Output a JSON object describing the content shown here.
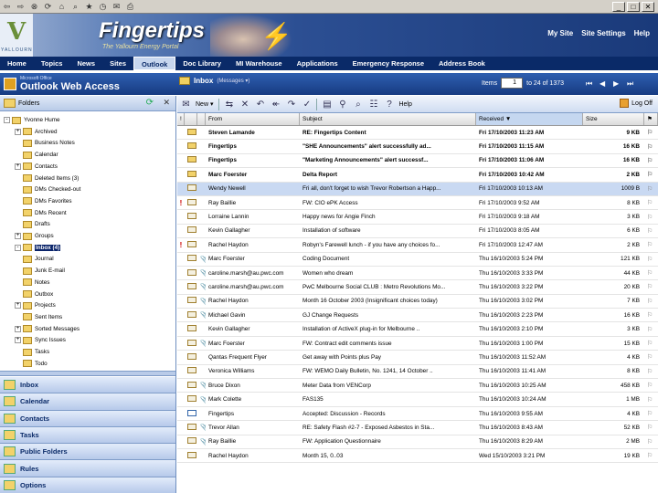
{
  "browser": {
    "buttons": [
      "back-arrow-icon",
      "forward-arrow-icon",
      "stop-icon",
      "refresh-icon",
      "home-icon",
      "search-icon",
      "favorites-icon",
      "history-icon",
      "mail-icon",
      "print-icon"
    ],
    "glyphs": [
      "⇦",
      "⇨",
      "⊗",
      "⟳",
      "⌂",
      "⌕",
      "★",
      "◷",
      "✉",
      "⎙"
    ],
    "window_controls": [
      "_",
      "□",
      "✕"
    ]
  },
  "banner": {
    "brand_letter": "V",
    "brand_text": "YALLOURN",
    "title": "Fingertips",
    "tagline": "The Yallourn Energy Portal",
    "links": [
      "My Site",
      "Site Settings",
      "Help"
    ]
  },
  "nav": {
    "items": [
      "Home",
      "Topics",
      "News",
      "Sites",
      "Outlook",
      "Doc Library",
      "MI Warehouse",
      "Applications",
      "Emergency Response",
      "Address Book"
    ],
    "active_index": 4
  },
  "owa": {
    "ms_label": "Microsoft Office",
    "title": "Outlook Web Access",
    "folder": "Inbox",
    "folder_view": "(Messages ▾)",
    "items_label": "Items",
    "page_value": "1",
    "range_label": "to 24 of 1373"
  },
  "folders": {
    "header": "Folders",
    "items": [
      {
        "label": "Yvonne Hume",
        "level": 0,
        "expand": "-"
      },
      {
        "label": "Archived",
        "level": 1,
        "expand": "+"
      },
      {
        "label": "Business Notes",
        "level": 1,
        "expand": ""
      },
      {
        "label": "Calendar",
        "level": 1,
        "expand": ""
      },
      {
        "label": "Contacts",
        "level": 1,
        "expand": "+"
      },
      {
        "label": "Deleted Items (3)",
        "level": 1,
        "expand": ""
      },
      {
        "label": "DMs Checked-out",
        "level": 1,
        "expand": ""
      },
      {
        "label": "DMs Favorites",
        "level": 1,
        "expand": ""
      },
      {
        "label": "DMs Recent",
        "level": 1,
        "expand": ""
      },
      {
        "label": "Drafts",
        "level": 1,
        "expand": ""
      },
      {
        "label": "Groups",
        "level": 1,
        "expand": "+"
      },
      {
        "label": "Inbox (4)",
        "level": 1,
        "expand": "-",
        "selected": true
      },
      {
        "label": "Journal",
        "level": 1,
        "expand": ""
      },
      {
        "label": "Junk E-mail",
        "level": 1,
        "expand": ""
      },
      {
        "label": "Notes",
        "level": 1,
        "expand": ""
      },
      {
        "label": "Outbox",
        "level": 1,
        "expand": ""
      },
      {
        "label": "Projects",
        "level": 1,
        "expand": "+"
      },
      {
        "label": "Sent Items",
        "level": 1,
        "expand": ""
      },
      {
        "label": "Sorted Messages",
        "level": 1,
        "expand": "+"
      },
      {
        "label": "Sync Issues",
        "level": 1,
        "expand": "+"
      },
      {
        "label": "Tasks",
        "level": 1,
        "expand": ""
      },
      {
        "label": "Todo",
        "level": 1,
        "expand": ""
      }
    ]
  },
  "shortcuts": [
    "Inbox",
    "Calendar",
    "Contacts",
    "Tasks",
    "Public Folders",
    "Rules",
    "Options"
  ],
  "toolbar": {
    "new_label": "New ▾",
    "help_label": "Help",
    "logoff_label": "Log Off"
  },
  "columns": {
    "importance": "!",
    "icon": "",
    "attachment": "",
    "from": "From",
    "subject": "Subject",
    "received": "Received ▼",
    "size": "Size",
    "flag": "⚑"
  },
  "messages": [
    {
      "imp": "",
      "type": "mail",
      "att": "",
      "from": "Steven Lamande",
      "subject": "RE: Fingertips Content",
      "received": "Fri 17/10/2003 11:23 AM",
      "size": "9 KB",
      "unread": true,
      "selected": false
    },
    {
      "imp": "",
      "type": "mail",
      "att": "",
      "from": "Fingertips",
      "subject": "\"SHE Announcements\" alert successfully ad...",
      "received": "Fri 17/10/2003 11:15 AM",
      "size": "16 KB",
      "unread": true,
      "selected": false
    },
    {
      "imp": "",
      "type": "mail",
      "att": "",
      "from": "Fingertips",
      "subject": "\"Marketing Announcements\" alert successf...",
      "received": "Fri 17/10/2003 11:06 AM",
      "size": "16 KB",
      "unread": true,
      "selected": false
    },
    {
      "imp": "",
      "type": "mail",
      "att": "",
      "from": "Marc Foerster",
      "subject": "Delta Report",
      "received": "Fri 17/10/2003 10:42 AM",
      "size": "2 KB",
      "unread": true,
      "selected": false
    },
    {
      "imp": "",
      "type": "read",
      "att": "",
      "from": "Wendy Newell",
      "subject": "Fri all, don't forget to wish Trevor Robertson a Happ...",
      "received": "Fri 17/10/2003 10:13 AM",
      "size": "1009 B",
      "unread": false,
      "selected": true
    },
    {
      "imp": "!",
      "type": "read",
      "att": "",
      "from": "Ray Baillie",
      "subject": "FW: CIO ePK Access",
      "received": "Fri 17/10/2003 9:52 AM",
      "size": "8 KB",
      "unread": false,
      "selected": false
    },
    {
      "imp": "",
      "type": "read",
      "att": "",
      "from": "Lorraine Lannin",
      "subject": "Happy news for Angie Finch",
      "received": "Fri 17/10/2003 9:18 AM",
      "size": "3 KB",
      "unread": false,
      "selected": false
    },
    {
      "imp": "",
      "type": "read",
      "att": "",
      "from": "Kevin Gallagher",
      "subject": "Installation of software",
      "received": "Fri 17/10/2003 8:05 AM",
      "size": "6 KB",
      "unread": false,
      "selected": false
    },
    {
      "imp": "!",
      "type": "read",
      "att": "",
      "from": "Rachel Haydon",
      "subject": "Robyn's Farewell lunch - if you have any choices fo...",
      "received": "Fri 17/10/2003 12:47 AM",
      "size": "2 KB",
      "unread": false,
      "selected": false
    },
    {
      "imp": "",
      "type": "read",
      "att": "📎",
      "from": "Marc Foerster",
      "subject": "Coding Document",
      "received": "Thu 16/10/2003 5:24 PM",
      "size": "121 KB",
      "unread": false,
      "selected": false
    },
    {
      "imp": "",
      "type": "read",
      "att": "📎",
      "from": "caroline.marsh@au.pwc.com",
      "subject": "Women who dream",
      "received": "Thu 16/10/2003 3:33 PM",
      "size": "44 KB",
      "unread": false,
      "selected": false
    },
    {
      "imp": "",
      "type": "read",
      "att": "📎",
      "from": "caroline.marsh@au.pwc.com",
      "subject": "PwC Melbourne Social CLUB : Metro Revolutions Mo...",
      "received": "Thu 16/10/2003 3:22 PM",
      "size": "20 KB",
      "unread": false,
      "selected": false
    },
    {
      "imp": "",
      "type": "read",
      "att": "📎",
      "from": "Rachel Haydon",
      "subject": "Month 16 October 2003 (Insignificant choices today)",
      "received": "Thu 16/10/2003 3:02 PM",
      "size": "7 KB",
      "unread": false,
      "selected": false
    },
    {
      "imp": "",
      "type": "read",
      "att": "📎",
      "from": "Michael Gavin",
      "subject": "GJ Change Requests",
      "received": "Thu 16/10/2003 2:23 PM",
      "size": "16 KB",
      "unread": false,
      "selected": false
    },
    {
      "imp": "",
      "type": "read",
      "att": "",
      "from": "Kevin Gallagher",
      "subject": "Installation of ActiveX plug-in for Melbourne ..",
      "received": "Thu 16/10/2003 2:10 PM",
      "size": "3 KB",
      "unread": false,
      "selected": false
    },
    {
      "imp": "",
      "type": "read",
      "att": "📎",
      "from": "Marc Foerster",
      "subject": "FW: Contract edit comments issue",
      "received": "Thu 16/10/2003 1:00 PM",
      "size": "15 KB",
      "unread": false,
      "selected": false
    },
    {
      "imp": "",
      "type": "read",
      "att": "",
      "from": "Qantas Frequent Flyer",
      "subject": "Get away with Points plus Pay",
      "received": "Thu 16/10/2003 11:52 AM",
      "size": "4 KB",
      "unread": false,
      "selected": false
    },
    {
      "imp": "",
      "type": "read",
      "att": "",
      "from": "Veronica Williams",
      "subject": "FW: WEMO Daily Bulletin, No. 1241, 14 October ..",
      "received": "Thu 16/10/2003 11:41 AM",
      "size": "8 KB",
      "unread": false,
      "selected": false
    },
    {
      "imp": "",
      "type": "read",
      "att": "📎",
      "from": "Bruce Dixon",
      "subject": "Meter Data from VENCorp",
      "received": "Thu 16/10/2003 10:25 AM",
      "size": "458 KB",
      "unread": false,
      "selected": false
    },
    {
      "imp": "",
      "type": "read",
      "att": "📎",
      "from": "Mark Colette",
      "subject": "FAS135",
      "received": "Thu 16/10/2003 10:24 AM",
      "size": "1 MB",
      "unread": false,
      "selected": false
    },
    {
      "imp": "",
      "type": "task",
      "att": "",
      "from": "Fingertips",
      "subject": "Accepted: Discussion - Records",
      "received": "Thu 16/10/2003 9:55 AM",
      "size": "4 KB",
      "unread": false,
      "selected": false
    },
    {
      "imp": "",
      "type": "read",
      "att": "📎",
      "from": "Trevor Allan",
      "subject": "RE: Safety Flash #2-7 - Exposed Asbestos in Sta...",
      "received": "Thu 16/10/2003 8:43 AM",
      "size": "52 KB",
      "unread": false,
      "selected": false
    },
    {
      "imp": "",
      "type": "read",
      "att": "📎",
      "from": "Ray Baillie",
      "subject": "FW: Application Questionnaire",
      "received": "Thu 16/10/2003 8:29 AM",
      "size": "2 MB",
      "unread": false,
      "selected": false
    },
    {
      "imp": "",
      "type": "read",
      "att": "",
      "from": "Rachel Haydon",
      "subject": "Month 15, 0..03",
      "received": "Wed 15/10/2003 3:21 PM",
      "size": "19 KB",
      "unread": false,
      "selected": false
    }
  ]
}
